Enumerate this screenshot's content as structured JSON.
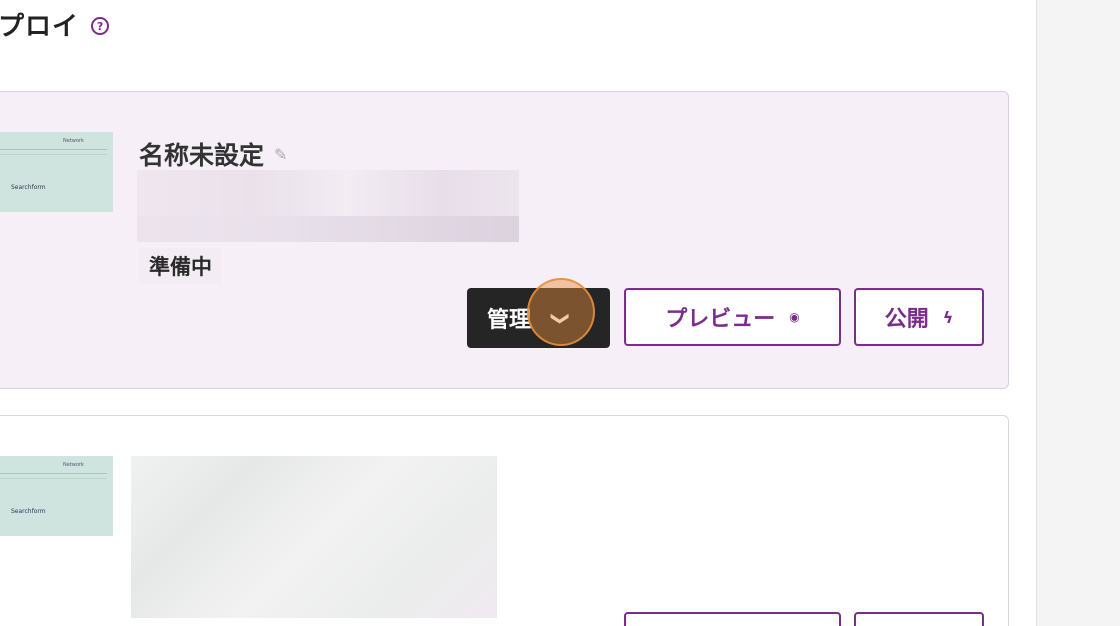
{
  "header": {
    "title": "プロイ",
    "help_icon": "help-circle-icon"
  },
  "deployments": [
    {
      "name": "名称未設定",
      "status": "準備中",
      "thumbnail": {
        "logo": "Network",
        "heading": "Searchform"
      },
      "actions": {
        "manage_label": "管理",
        "preview_label": "プレビュー",
        "publish_label": "公開"
      }
    },
    {
      "thumbnail": {
        "logo": "Network",
        "heading": "Searchform"
      }
    }
  ],
  "colors": {
    "accent": "#7b2d8b",
    "card_active_bg": "#f7eff8",
    "manage_bg": "#252525"
  }
}
